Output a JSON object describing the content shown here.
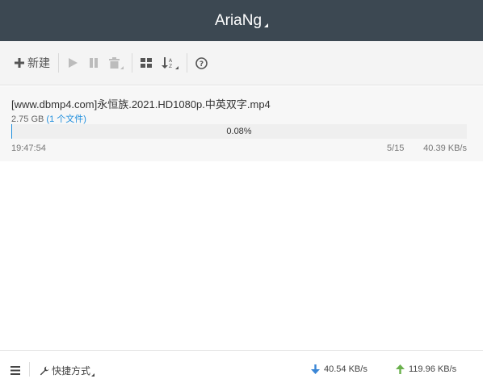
{
  "app": {
    "title": "AriaNg"
  },
  "toolbar": {
    "new_label": "新建",
    "icons": [
      "plus-icon",
      "play-icon",
      "pause-icon",
      "trash-icon",
      "grid-icon",
      "sort-az-icon",
      "help-icon"
    ]
  },
  "task": {
    "name": "[www.dbmp4.com]永恒族.2021.HD1080p.中英双字.mp4",
    "size": "2.75 GB",
    "files": "(1 个文件)",
    "progress_text": "0.08%",
    "progress_fraction": 0.0008,
    "time": "19:47:54",
    "connections": "5/15",
    "speed": "40.39 KB/s"
  },
  "footer": {
    "shortcut_label": "快捷方式",
    "download_speed": "40.54 KB/s",
    "upload_speed": "119.96 KB/s"
  },
  "colors": {
    "header_bg": "#3c4852",
    "accent": "#208fdd",
    "upload_arrow": "#6ab04c",
    "download_arrow": "#3a86d6"
  }
}
